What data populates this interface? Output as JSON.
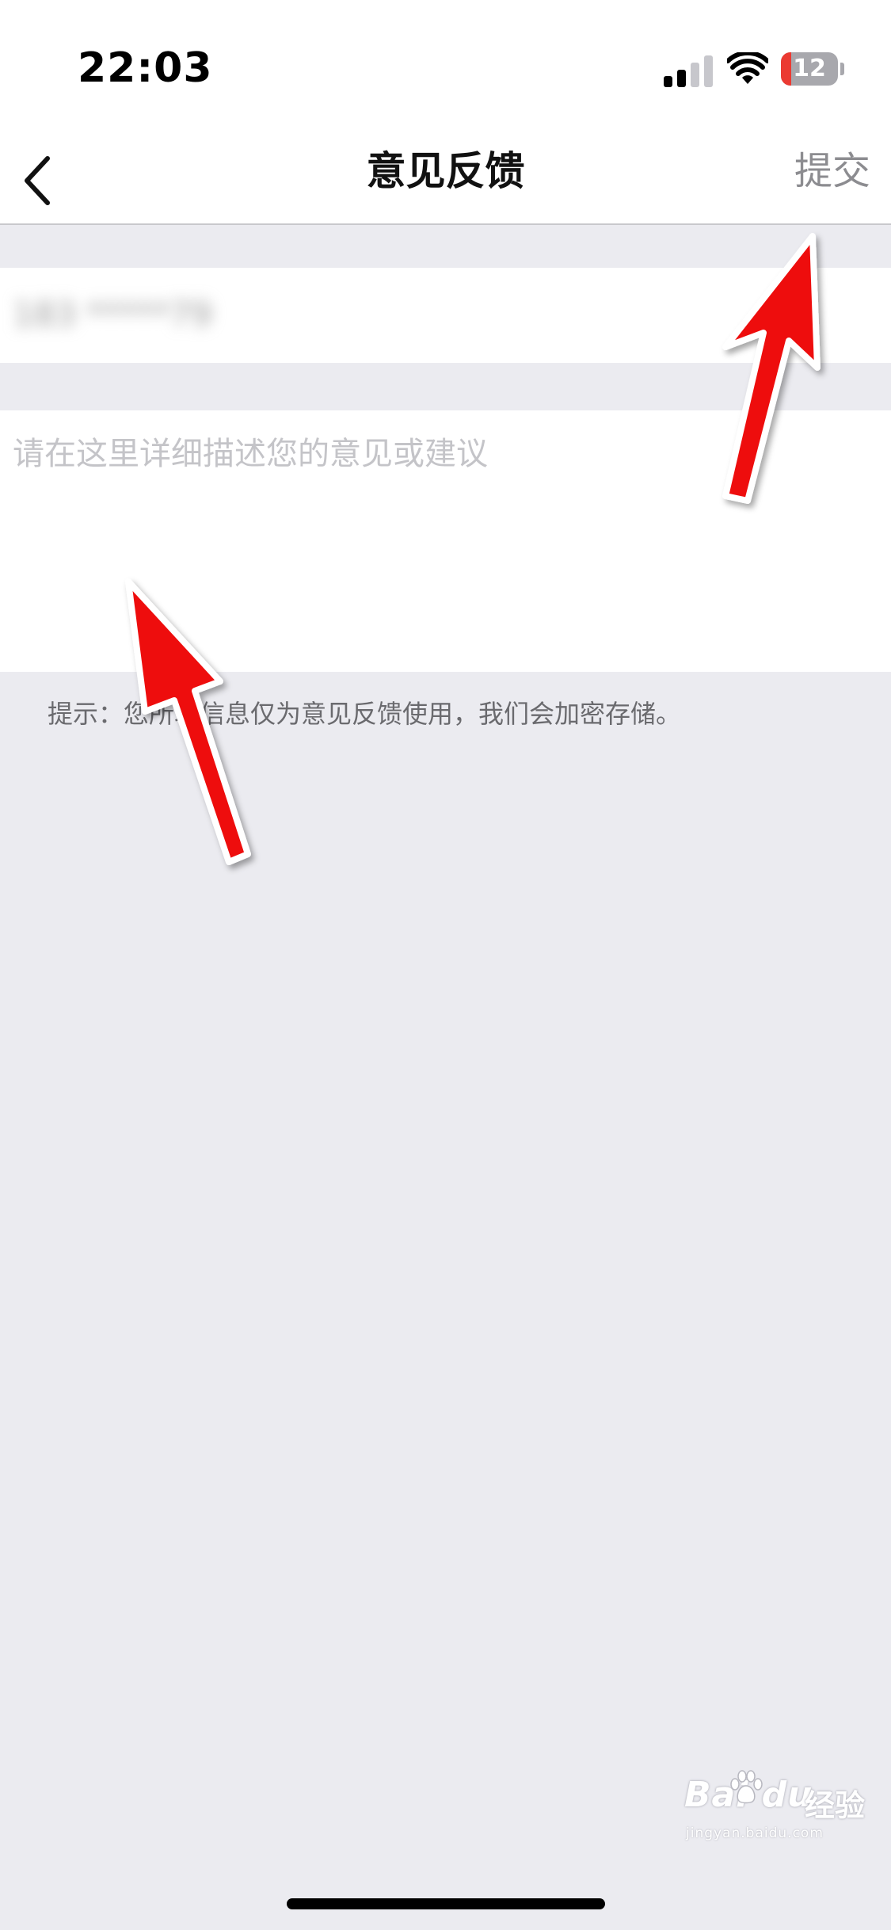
{
  "status_bar": {
    "time": "22:03",
    "battery_level": "12",
    "battery_fraction": 0.12,
    "signal_bars_active": 2,
    "signal_bars_total": 4,
    "icons": [
      "signal-icon",
      "wifi-icon",
      "battery-icon"
    ]
  },
  "nav": {
    "back_icon": "chevron-left-icon",
    "title": "意见反馈",
    "submit_label": "提交"
  },
  "form": {
    "contact_value": "183 *****79",
    "feedback_placeholder": "请在这里详细描述您的意见或建议",
    "hint": "提示：您所填信息仅为意见反馈使用，我们会加密存储。"
  },
  "watermark": {
    "brand": "Bai du",
    "product": "经验",
    "url": "jingyan.baidu.com"
  },
  "colors": {
    "background": "#ebebf0",
    "arrow": "#ee1111",
    "submit_text": "#8c8c90",
    "battery_low": "#eb3a32"
  }
}
